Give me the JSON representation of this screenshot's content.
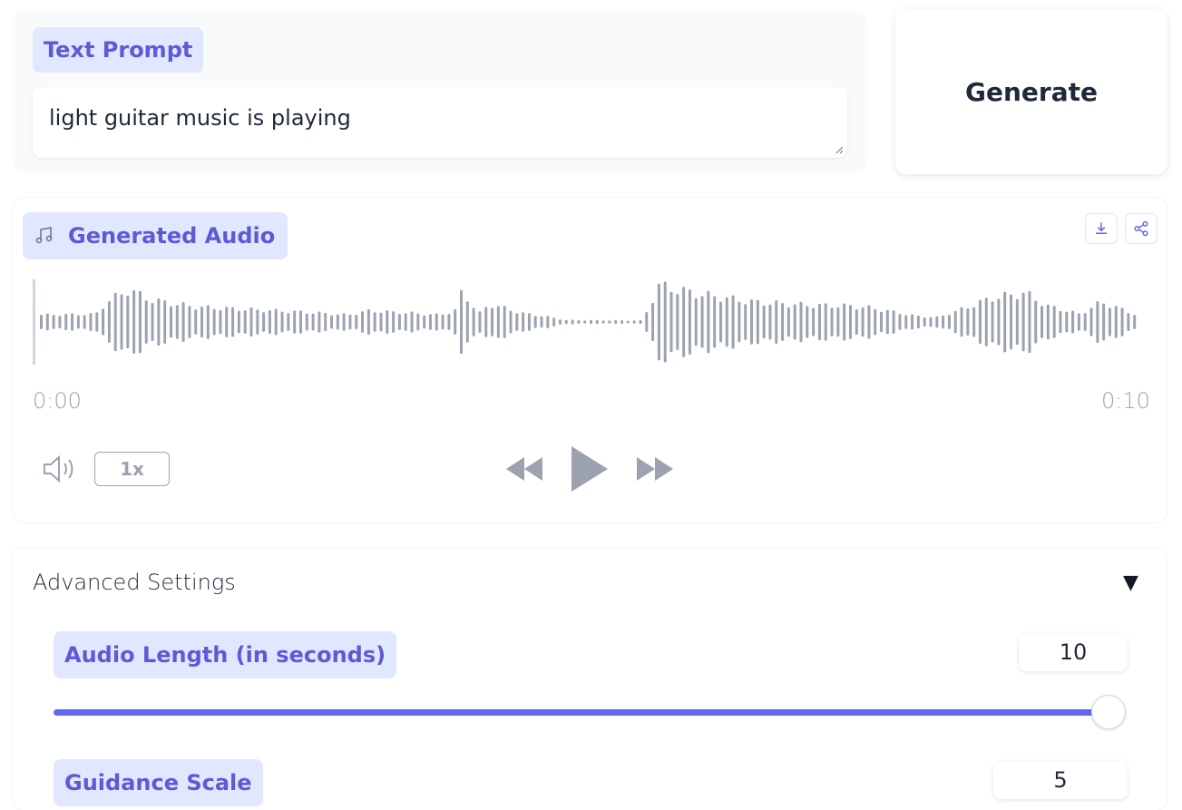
{
  "prompt": {
    "label": "Text Prompt",
    "value": "light guitar music is playing"
  },
  "generate_label": "Generate",
  "audio": {
    "label": "Generated Audio",
    "time_start": "0:00",
    "time_end": "0:10",
    "speed": "1x",
    "progress": 0.0,
    "icons": {
      "label_icon": "music-note-icon",
      "download": "download-icon",
      "share": "share-icon",
      "volume": "volume-icon",
      "rewind": "rewind-icon",
      "play": "play-icon",
      "forward": "fast-forward-icon"
    }
  },
  "advanced": {
    "title": "Advanced Settings",
    "toggle_icon": "triangle-down-icon",
    "audio_length": {
      "label": "Audio Length (in seconds)",
      "value": "10",
      "fraction": 1.0
    },
    "guidance_scale": {
      "label": "Guidance Scale",
      "value": "5"
    }
  },
  "colors": {
    "accent": "#6366f1",
    "tag_bg": "#e0e7ff",
    "tag_text": "#5b5bd6",
    "waveform": "#9ca3af"
  }
}
